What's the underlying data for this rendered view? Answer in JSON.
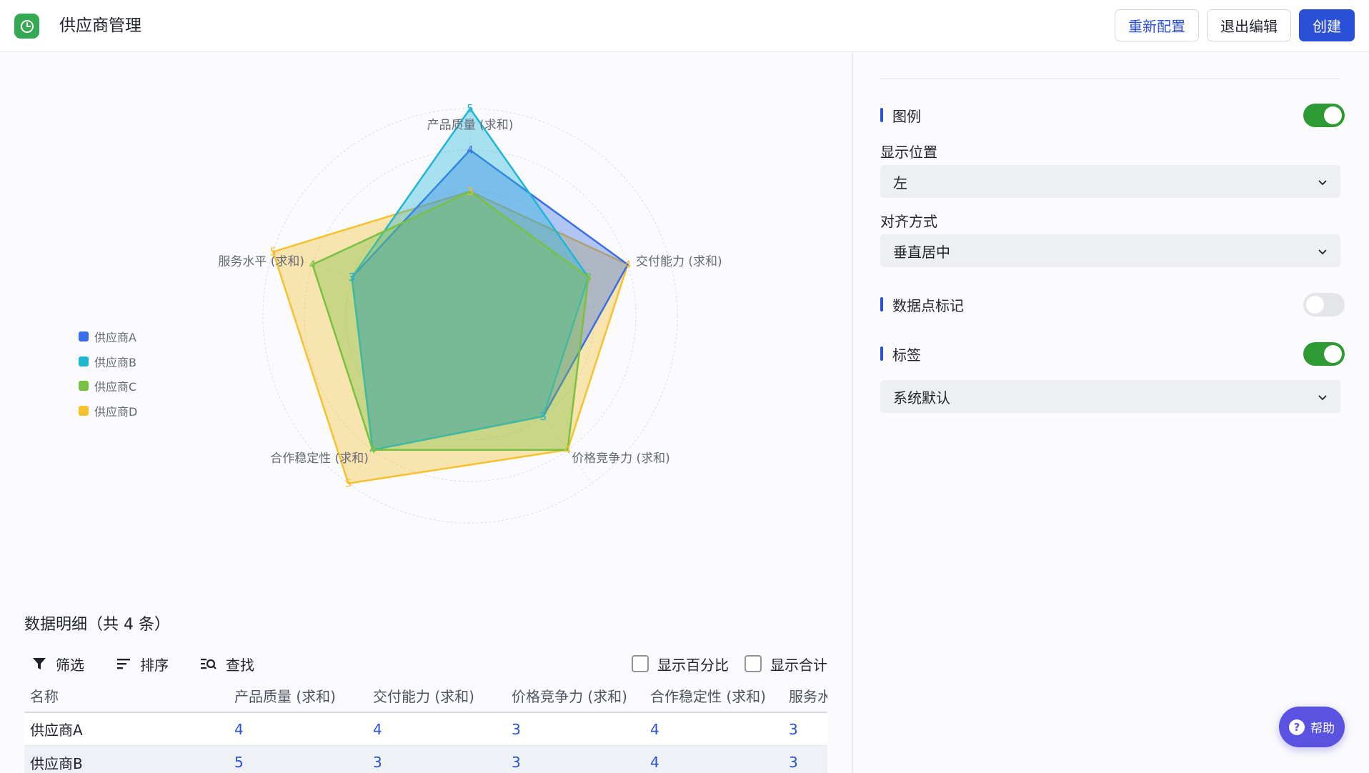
{
  "header": {
    "title": "供应商管理",
    "reconfig_label": "重新配置",
    "exit_label": "退出编辑",
    "create_label": "创建"
  },
  "colors": {
    "accent": "#2a50d8",
    "toggle_on": "#2e9a33",
    "supplier_a": "#3a6ee8",
    "supplier_b": "#1fb6d6",
    "supplier_c": "#78c142",
    "supplier_d": "#f5c12e"
  },
  "chart_data": {
    "type": "radar",
    "axes": [
      "产品质量 (求和)",
      "交付能力 (求和)",
      "价格竞争力 (求和)",
      "合作稳定性 (求和)",
      "服务水平 (求和)"
    ],
    "rmax": 5,
    "series": [
      {
        "name": "供应商A",
        "values": [
          4,
          4,
          3,
          4,
          3
        ]
      },
      {
        "name": "供应商B",
        "values": [
          5,
          3,
          3,
          4,
          3
        ]
      },
      {
        "name": "供应商C",
        "values": [
          3,
          3,
          4,
          4,
          4
        ]
      },
      {
        "name": "供应商D",
        "values": [
          3,
          4,
          4,
          5,
          5
        ]
      }
    ],
    "legend_position": "left"
  },
  "table": {
    "title": "数据明细（共 4 条）",
    "toolbar": {
      "filter_label": "筛选",
      "sort_label": "排序",
      "search_label": "查找",
      "show_percent_label": "显示百分比",
      "show_total_label": "显示合计"
    },
    "columns": [
      "名称",
      "产品质量 (求和)",
      "交付能力 (求和)",
      "价格竞争力 (求和)",
      "合作稳定性 (求和)",
      "服务水平 (求和)"
    ],
    "rows": [
      {
        "name": "供应商A",
        "c1": "4",
        "c2": "4",
        "c3": "3",
        "c4": "4",
        "c5": "3"
      },
      {
        "name": "供应商B",
        "c1": "5",
        "c2": "3",
        "c3": "3",
        "c4": "4",
        "c5": "3"
      }
    ]
  },
  "settings": {
    "legend": {
      "label": "图例",
      "enabled": true
    },
    "position": {
      "label": "显示位置",
      "value": "左"
    },
    "align": {
      "label": "对齐方式",
      "value": "垂直居中"
    },
    "markers": {
      "label": "数据点标记",
      "enabled": false
    },
    "labels": {
      "label": "标签",
      "enabled": true,
      "value": "系统默认"
    }
  },
  "help": {
    "label": "帮助"
  }
}
